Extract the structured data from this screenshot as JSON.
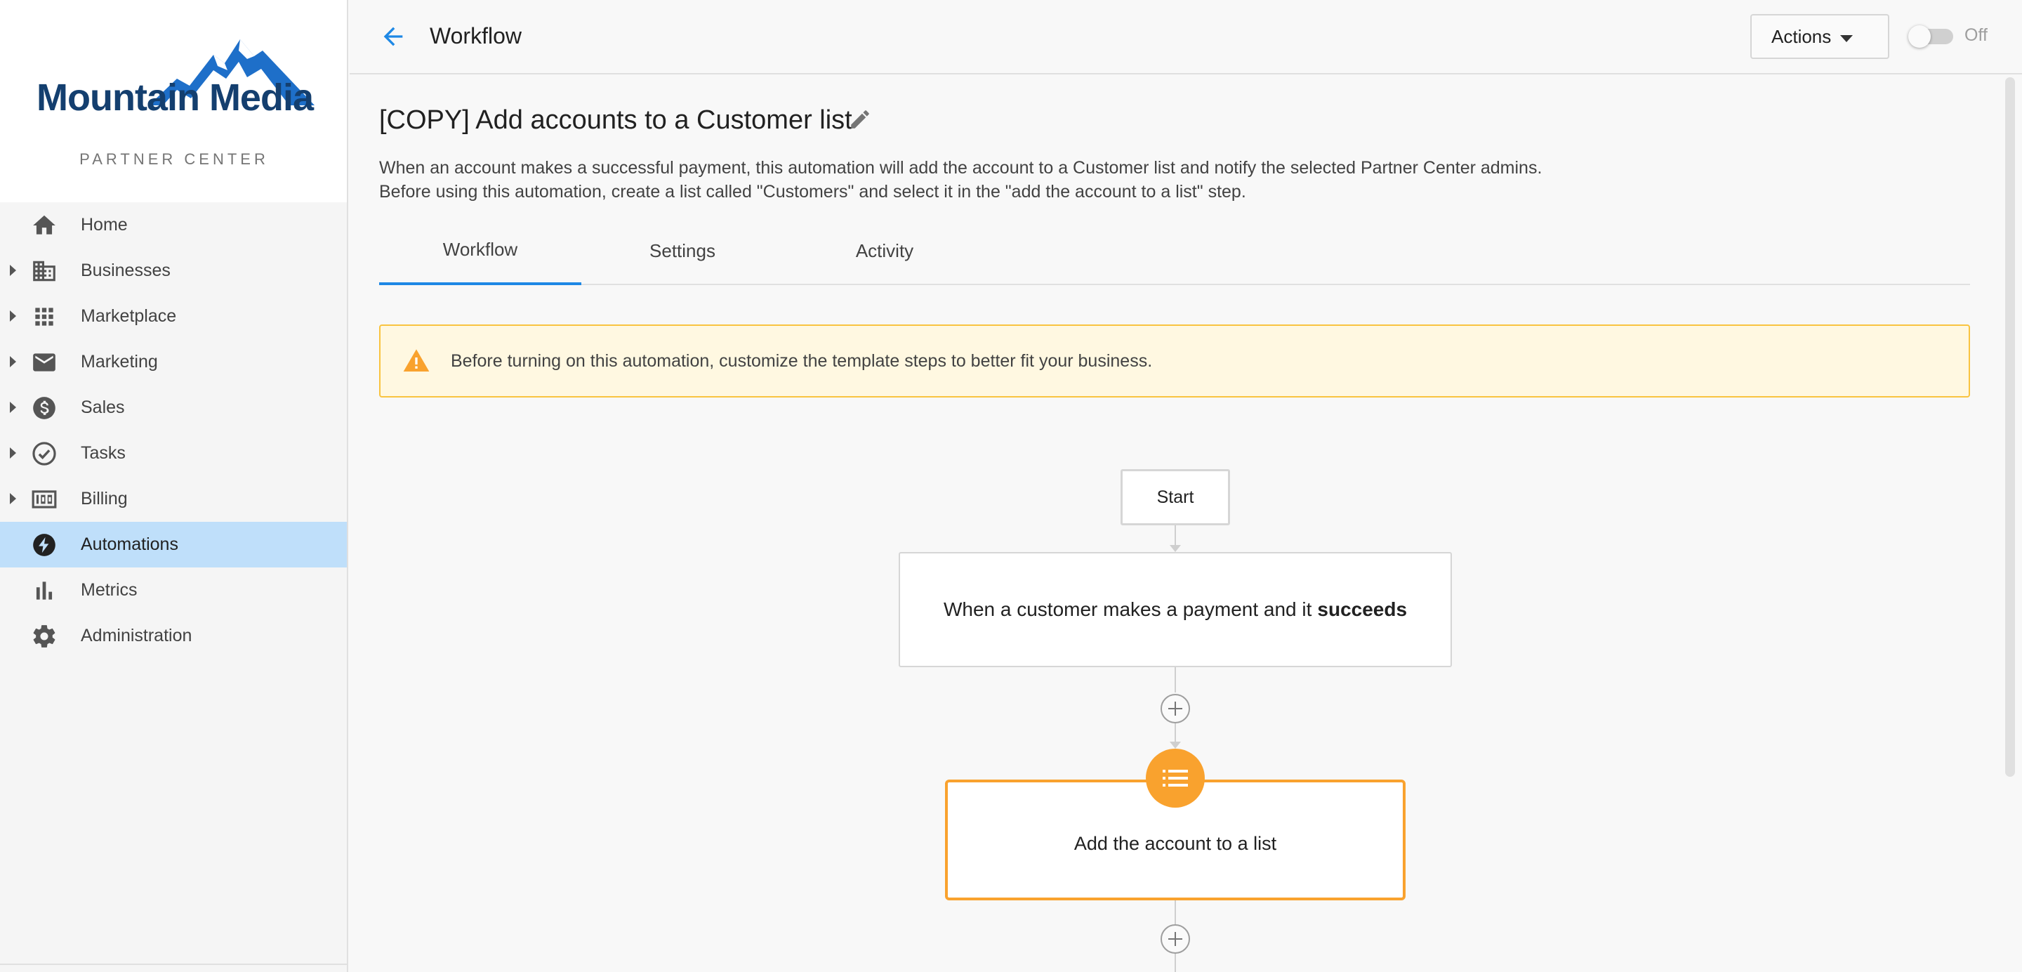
{
  "brand": {
    "name": "Mountain Media",
    "subtitle": "PARTNER CENTER"
  },
  "sidebar": {
    "items": [
      {
        "label": "Home",
        "icon": "home-icon",
        "expandable": false
      },
      {
        "label": "Businesses",
        "icon": "building-icon",
        "expandable": true
      },
      {
        "label": "Marketplace",
        "icon": "grid-icon",
        "expandable": true
      },
      {
        "label": "Marketing",
        "icon": "mail-icon",
        "expandable": true
      },
      {
        "label": "Sales",
        "icon": "dollar-icon",
        "expandable": true
      },
      {
        "label": "Tasks",
        "icon": "check-circle-icon",
        "expandable": true
      },
      {
        "label": "Billing",
        "icon": "billing-icon",
        "expandable": true
      },
      {
        "label": "Automations",
        "icon": "bolt-icon",
        "expandable": false,
        "active": true
      },
      {
        "label": "Metrics",
        "icon": "bar-chart-icon",
        "expandable": false
      },
      {
        "label": "Administration",
        "icon": "gear-icon",
        "expandable": false
      }
    ]
  },
  "topbar": {
    "title": "Workflow",
    "actions_label": "Actions",
    "toggle_label": "Off"
  },
  "page": {
    "title": "[COPY] Add accounts to a Customer list",
    "description": "When an account makes a successful payment, this automation will add the account to a Customer list and notify the selected Partner Center admins. Before using this automation, create a list called \"Customers\" and select it in the \"add the account to a list\" step."
  },
  "tabs": [
    {
      "label": "Workflow",
      "active": true
    },
    {
      "label": "Settings",
      "active": false
    },
    {
      "label": "Activity",
      "active": false
    }
  ],
  "alert": {
    "text": "Before turning on this automation, customize the template steps to better fit your business."
  },
  "workflow": {
    "start_label": "Start",
    "trigger_text": "When a customer makes a payment and it",
    "trigger_emphasis": "succeeds",
    "action_label": "Add the account to a list"
  },
  "colors": {
    "accent": "#1e88e5",
    "active_nav": "#bfdffa",
    "warning": "#f9a22e",
    "alert_bg": "#fff8e1",
    "brand_blue": "#143f6f"
  }
}
